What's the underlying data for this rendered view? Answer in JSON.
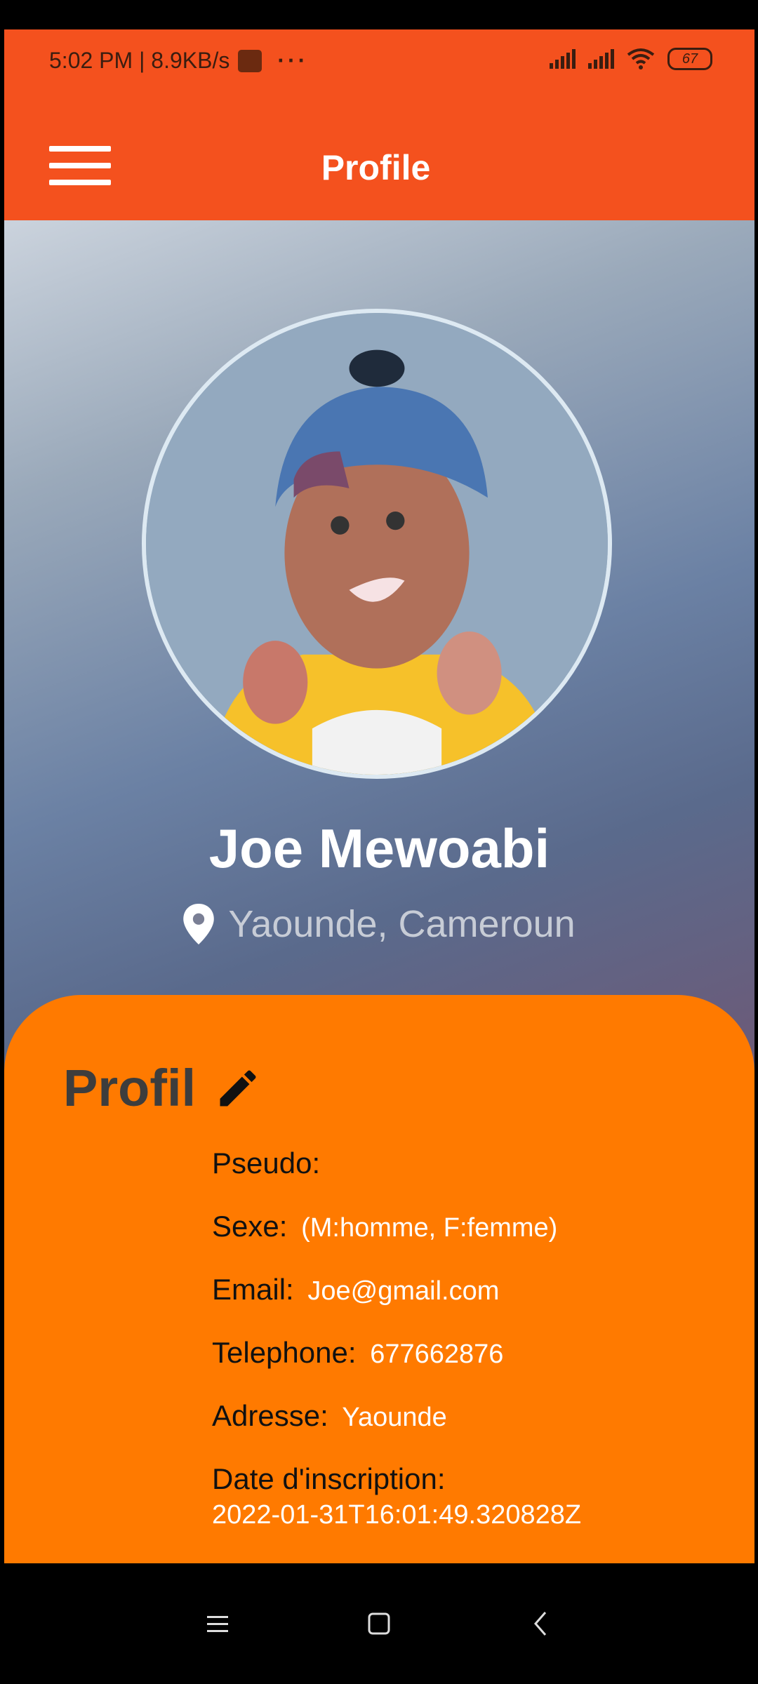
{
  "status_bar": {
    "time_net": "5:02 PM | 8.9KB/s",
    "more": "···",
    "battery": "67"
  },
  "app_bar": {
    "title": "Profile",
    "menu_icon": "hamburger-icon"
  },
  "profile": {
    "name": "Joe Mewoabi",
    "location": "Yaounde, Cameroun",
    "location_icon": "map-pin-icon"
  },
  "card": {
    "title": "Profil",
    "edit_icon": "pencil-icon",
    "fields": {
      "pseudo_label": "Pseudo:",
      "sexe_label": "Sexe:",
      "sexe_value": "(M:homme, F:femme)",
      "email_label": "Email:",
      "email_value": "Joe@gmail.com",
      "telephone_label": "Telephone:",
      "telephone_value": "677662876",
      "adresse_label": "Adresse:",
      "adresse_value": "Yaounde",
      "date_label": "Date d'inscription:",
      "date_value": "2022-01-31T16:01:49.320828Z"
    }
  },
  "colors": {
    "app_bar": "#f4511e",
    "card": "#ff7a00",
    "name": "#ffffff",
    "location": "#c7ccd6"
  }
}
